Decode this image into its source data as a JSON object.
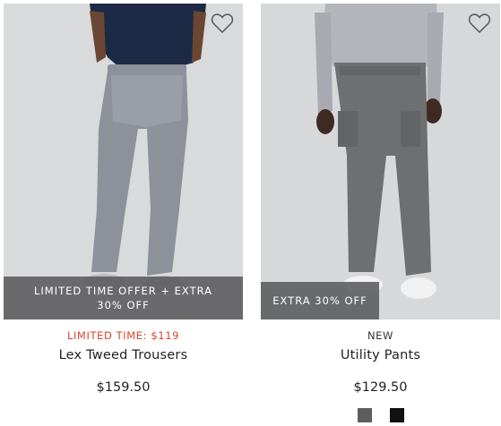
{
  "products": [
    {
      "badge": "LIMITED TIME OFFER + EXTRA 30% OFF",
      "tag": "LIMITED TIME: $119",
      "name": "Lex Tweed Trousers",
      "price": "$159.50",
      "wishlist_icon": "heart-outline-icon",
      "tag_color": "#d8452e"
    },
    {
      "badge": "EXTRA 30% OFF",
      "tag": "NEW",
      "name": "Utility Pants",
      "price": "$129.50",
      "wishlist_icon": "heart-outline-icon",
      "swatches": [
        {
          "color": "#5d5e60"
        },
        {
          "color": "#111111"
        }
      ]
    }
  ]
}
